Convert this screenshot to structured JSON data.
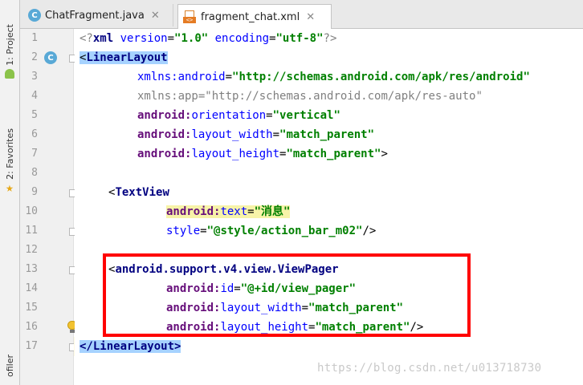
{
  "toolstrip": {
    "project_label": "1: Project",
    "favorites_label": "2: Favorites",
    "profiler_label": "ofiler"
  },
  "tabs": [
    {
      "label": "ChatFragment.java",
      "icon": "class-c-icon",
      "active": false
    },
    {
      "label": "fragment_chat.xml",
      "icon": "xml-file-icon",
      "active": true
    }
  ],
  "gutter": {
    "line_numbers": [
      "1",
      "2",
      "3",
      "4",
      "5",
      "6",
      "7",
      "8",
      "9",
      "10",
      "11",
      "12",
      "13",
      "14",
      "15",
      "16",
      "17"
    ],
    "class_marker": "C"
  },
  "code": {
    "l1": {
      "a": "<?",
      "b": "xml ",
      "c": "version",
      "d": "=",
      "e": "\"1.0\"",
      "f": " ",
      "g": "encoding",
      "h": "=",
      "i": "\"utf-8\"",
      "j": "?>"
    },
    "l2": {
      "lt": "<",
      "tag": "LinearLayout"
    },
    "l3": {
      "ns": "xmlns:android",
      "eq": "=",
      "val": "\"http://schemas.android.com/apk/res/android\""
    },
    "l4": {
      "ns": "xmlns:app",
      "eq": "=",
      "val": "\"http://schemas.android.com/apk/res-auto\""
    },
    "l5": {
      "ns": "android:",
      "attr": "orientation",
      "eq": "=",
      "val": "\"vertical\""
    },
    "l6": {
      "ns": "android:",
      "attr": "layout_width",
      "eq": "=",
      "val": "\"match_parent\""
    },
    "l7": {
      "ns": "android:",
      "attr": "layout_height",
      "eq": "=",
      "val": "\"match_parent\"",
      "end": ">"
    },
    "l9": {
      "lt": "<",
      "tag": "TextView"
    },
    "l10": {
      "ns": "android:",
      "attr": "text",
      "eq": "=",
      "val": "\"消息\""
    },
    "l11": {
      "attr": "style",
      "eq": "=",
      "val": "\"@style/action_bar_m02\"",
      "end": "/>"
    },
    "l13": {
      "lt": "<",
      "tag": "android.support.v4.view.ViewPager"
    },
    "l14": {
      "ns": "android:",
      "attr": "id",
      "eq": "=",
      "val": "\"@+id/view_pager\""
    },
    "l15": {
      "ns": "android:",
      "attr": "layout_width",
      "eq": "=",
      "val": "\"match_parent\""
    },
    "l16": {
      "ns": "android:",
      "attr": "layout_height",
      "eq": "=",
      "val": "\"match_parent\"",
      "end": "/>"
    },
    "l17": {
      "text": "</LinearLayout>"
    }
  },
  "watermark": "https://blog.csdn.net/u013718730",
  "colors": {
    "annotation_box": "#ff0000",
    "tag_blue": "#000080",
    "namespace_purple": "#660e7a",
    "attribute_blue": "#0000ff",
    "string_green": "#008000",
    "selection": "#a6d2ff"
  }
}
